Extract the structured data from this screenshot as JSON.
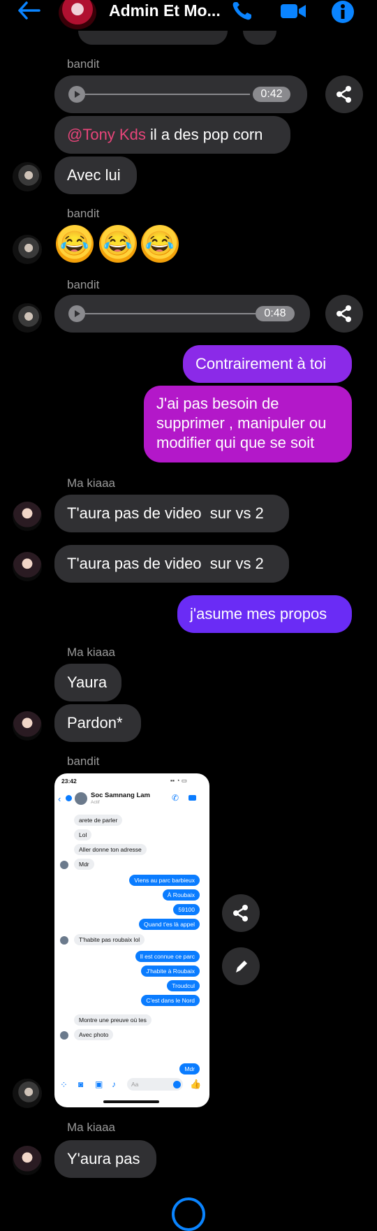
{
  "header": {
    "title": "Admin Et Mo..."
  },
  "colors": {
    "accent": "#0a84ff",
    "bubble_in": "#303033",
    "bubble_out_blue": "#6a2cf5",
    "bubble_out_magenta": "#b318c9",
    "mention": "#e8457a"
  },
  "messages": {
    "sender1": "bandit",
    "audio1_time": "0:42",
    "msg_mention": "@Tony Kds",
    "msg_mention_rest": " il a des pop corn",
    "msg_avec_lui": "Avec lui",
    "sender2": "bandit",
    "sender3": "bandit",
    "audio2_time": "0:48",
    "out1": "Contrairement à toi",
    "out2_line1": "J'ai pas besoin de",
    "out2_line2": "supprimer , manipuler ou",
    "out2_line3": "modifier qui que se soit",
    "sender4": "Ma kiaaa",
    "in_taura1": "T'aura pas de video  sur vs 2",
    "in_taura2": "T'aura pas de video  sur vs 2",
    "out3": "j'asume mes propos",
    "sender5": "Ma kiaaa",
    "in_yaura": "Yaura",
    "in_pardon": "Pardon*",
    "sender6": "bandit",
    "sender7": "Ma kiaaa",
    "in_yaura_pas": "Y'aura pas"
  },
  "screenshot": {
    "time": "23:42",
    "contact": "Soc Samnang Lam",
    "status": "Actif",
    "lines": [
      "arete de parler",
      "Lol",
      "Aller donne ton adresse",
      "Mdr",
      "Viens au parc barbieux",
      "À Roubaix",
      "59100",
      "Quand t'es là appel",
      "T'habite pas  roubaix lol",
      "Il est connue ce parc",
      "J'habite à Roubaix",
      "Troudcul",
      "C'est dans le Nord",
      "Montre une preuve où tes",
      "Avec photo",
      "Mdr"
    ],
    "composer_placeholder": "Aa"
  }
}
